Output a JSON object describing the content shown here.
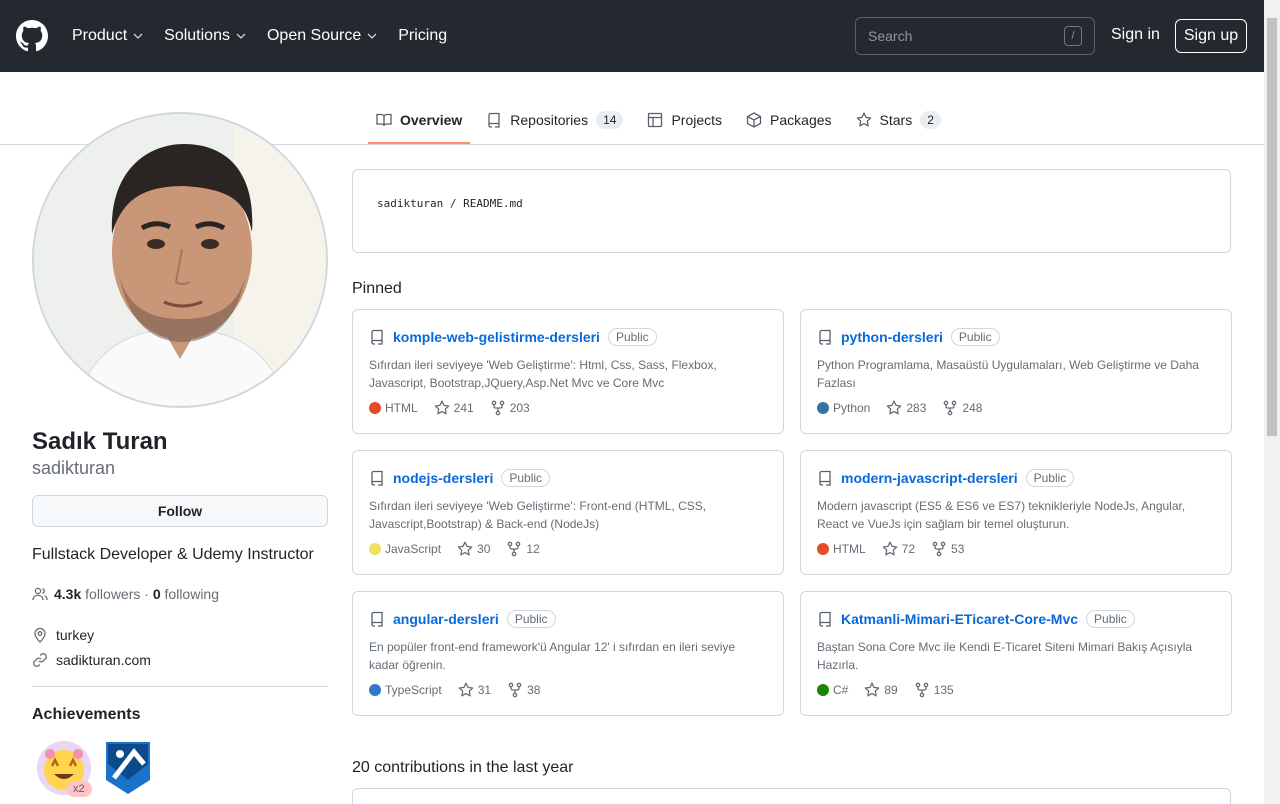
{
  "header": {
    "nav": [
      "Product",
      "Solutions",
      "Open Source",
      "Pricing"
    ],
    "search_placeholder": "Search",
    "search_hotkey": "/",
    "signin": "Sign in",
    "signup": "Sign up"
  },
  "tabs": [
    {
      "label": "Overview",
      "icon": "book-icon"
    },
    {
      "label": "Repositories",
      "count": "14",
      "icon": "repo-icon"
    },
    {
      "label": "Projects",
      "icon": "table-icon"
    },
    {
      "label": "Packages",
      "icon": "package-icon"
    },
    {
      "label": "Stars",
      "count": "2",
      "icon": "star-icon"
    }
  ],
  "profile": {
    "name": "Sadık Turan",
    "login": "sadikturan",
    "follow_label": "Follow",
    "bio": "Fullstack Developer & Udemy Instructor",
    "followers": "4.3k",
    "followers_label": "followers",
    "sep": "·",
    "following": "0",
    "following_label": "following",
    "location": "turkey",
    "website": "sadikturan.com",
    "achievements_title": "Achievements",
    "achievement_count": "x2"
  },
  "readme": {
    "owner": "sadikturan",
    "sep": "/",
    "file": "README.md"
  },
  "pinned_title": "Pinned",
  "pinned": [
    {
      "name": "komple-web-gelistirme-dersleri",
      "visibility": "Public",
      "desc": "Sıfırdan ileri seviyeye 'Web Geliştirme': Html, Css, Sass, Flexbox, Javascript, Bootstrap,JQuery,Asp.Net Mvc ve Core Mvc",
      "lang": "HTML",
      "color": "#e34c26",
      "stars": "241",
      "forks": "203"
    },
    {
      "name": "python-dersleri",
      "visibility": "Public",
      "desc": "Python Programlama, Masaüstü Uygulamaları, Web Geliştirme ve Daha Fazlası",
      "lang": "Python",
      "color": "#3572A5",
      "stars": "283",
      "forks": "248"
    },
    {
      "name": "nodejs-dersleri",
      "visibility": "Public",
      "desc": "Sıfırdan ileri seviyeye 'Web Geliştirme': Front-end (HTML, CSS, Javascript,Bootstrap) & Back-end (NodeJs)",
      "lang": "JavaScript",
      "color": "#f1e05a",
      "stars": "30",
      "forks": "12"
    },
    {
      "name": "modern-javascript-dersleri",
      "visibility": "Public",
      "desc": "Modern javascript (ES5 & ES6 ve ES7) teknikleriyle NodeJs, Angular, React ve VueJs için sağlam bir temel oluşturun.",
      "lang": "HTML",
      "color": "#e34c26",
      "stars": "72",
      "forks": "53"
    },
    {
      "name": "angular-dersleri",
      "visibility": "Public",
      "desc": "En popüler front-end framework'ü Angular 12' i sıfırdan en ileri seviye kadar öğrenin.",
      "lang": "TypeScript",
      "color": "#3178c6",
      "stars": "31",
      "forks": "38"
    },
    {
      "name": "Katmanli-Mimari-ETicaret-Core-Mvc",
      "visibility": "Public",
      "desc": "Baştan Sona Core Mvc ile Kendi E-Ticaret Siteni Mimari Bakış Açısıyla Hazırla.",
      "lang": "C#",
      "color": "#178600",
      "stars": "89",
      "forks": "135"
    }
  ],
  "contrib_title": "20 contributions in the last year"
}
